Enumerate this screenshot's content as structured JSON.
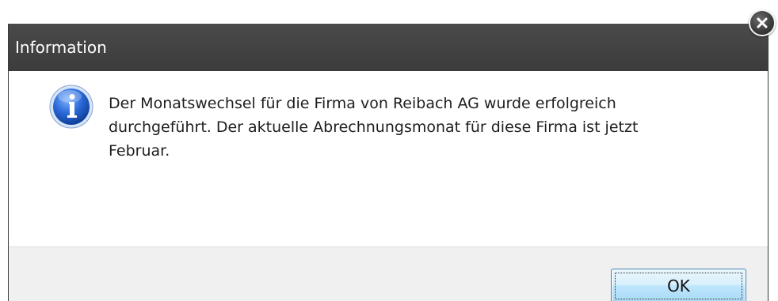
{
  "dialog": {
    "title": "Information",
    "message": "Der Monatswechsel für die Firma von Reibach AG wurde erfolgreich\ndurchgeführt. Der aktuelle Abrechnungsmonat für diese Firma ist jetzt\nFebruar.",
    "ok_label": "OK",
    "icon": "info-icon",
    "close_icon": "close-icon"
  },
  "colors": {
    "titlebar": "#3c3c3c",
    "footer": "#f0f0f0",
    "ok_border": "#3c7fb1",
    "info_blue": "#1a55b8"
  }
}
